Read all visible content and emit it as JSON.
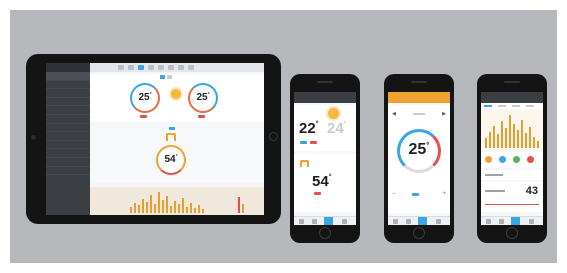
{
  "colors": {
    "background": "#b6b8bb",
    "device": "#141414",
    "accent_blue": "#3aa6e3",
    "accent_orange": "#f0a22e",
    "accent_red": "#e4504b"
  },
  "tablet": {
    "dial_left_value": "25",
    "dial_right_value": "25",
    "water_value": "54",
    "icons": [
      "sun-icon",
      "tap-icon"
    ]
  },
  "phone1": {
    "temp_main": "22",
    "temp_secondary": "24",
    "water_value": "54",
    "icons": [
      "sun-icon",
      "tap-icon"
    ]
  },
  "phone2": {
    "temp_value": "25"
  },
  "phone3": {
    "value": "43"
  },
  "degree": "°"
}
